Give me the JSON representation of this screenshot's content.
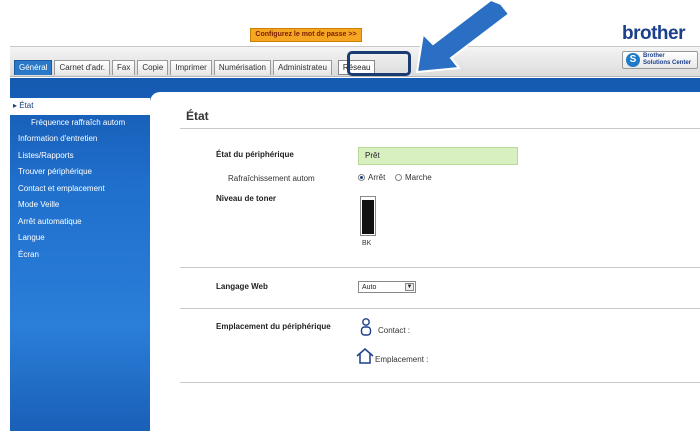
{
  "banner": {
    "password_link": "Configurez le mot de passe >>"
  },
  "brand": {
    "logo": "brother",
    "solutions_line1": "Brother",
    "solutions_line2": "Solutions Center"
  },
  "tabs": [
    {
      "label": "Général",
      "active": true
    },
    {
      "label": "Carnet d'adr."
    },
    {
      "label": "Fax"
    },
    {
      "label": "Copie"
    },
    {
      "label": "Imprimer"
    },
    {
      "label": "Numérisation"
    },
    {
      "label": "Administrateu"
    },
    {
      "label": "Réseau",
      "highlight": true
    }
  ],
  "sidebar": {
    "items": [
      {
        "label": "État",
        "active": true
      },
      {
        "label": "Fréquence raffraîch autom",
        "sub": true
      },
      {
        "label": "Information d'entretien"
      },
      {
        "label": "Listes/Rapports"
      },
      {
        "label": "Trouver périphérique"
      },
      {
        "label": "Contact et emplacement"
      },
      {
        "label": "Mode Veille"
      },
      {
        "label": "Arrêt automatique"
      },
      {
        "label": "Langue"
      },
      {
        "label": "Écran"
      }
    ]
  },
  "main": {
    "title": "État",
    "device_status_label": "État du périphérique",
    "device_status_value": "Prêt",
    "refresh_label": "Rafraîchissement autom",
    "refresh_options": [
      {
        "label": "Arrêt",
        "selected": true
      },
      {
        "label": "Marche",
        "selected": false
      }
    ],
    "toner_label": "Niveau de toner",
    "toner_color": "BK",
    "toner_level": 0.95,
    "web_language_label": "Langage Web",
    "web_language_value": "Auto",
    "location_label": "Emplacement du périphérique",
    "contact_label": "Contact :",
    "location_value_label": "Emplacement :"
  },
  "colors": {
    "accent_blue": "#1f6fcc",
    "status_green": "#d8efc0",
    "arrow": "#2a6fc4",
    "banner_orange": "#f5a623"
  }
}
